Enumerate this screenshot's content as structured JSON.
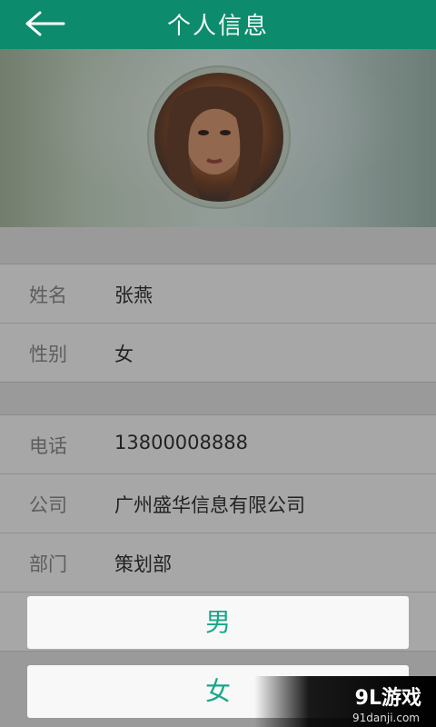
{
  "header": {
    "title": "个人信息"
  },
  "profile": {
    "rows_group1": [
      {
        "label": "姓名",
        "value": "张燕"
      },
      {
        "label": "性别",
        "value": "女"
      }
    ],
    "rows_group2": [
      {
        "label": "电话",
        "value": "13800008888"
      },
      {
        "label": "公司",
        "value": "广州盛华信息有限公司"
      },
      {
        "label": "部门",
        "value": "策划部"
      }
    ]
  },
  "gender_picker": {
    "options": [
      "男",
      "女"
    ]
  },
  "watermark": {
    "logo": "9L游戏",
    "url": "91danji.com"
  },
  "colors": {
    "titlebar": "#0c8c6c",
    "accent": "#16a887"
  }
}
